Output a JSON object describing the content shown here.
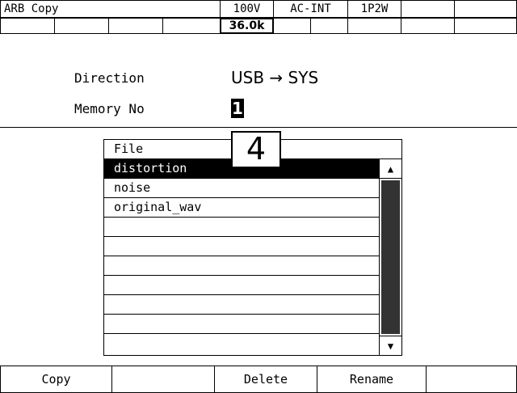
{
  "header": {
    "title": "ARB Copy",
    "voltage_range": "100V",
    "source_mode": "AC-INT",
    "wiring": "1P2W"
  },
  "status_bar": {
    "value": "36.0k"
  },
  "settings": {
    "direction_label": "Direction",
    "direction_value": "USB → SYS",
    "memory_label": "Memory No",
    "memory_value": "1",
    "memory_popup_value": "4"
  },
  "file_list": {
    "header": "File",
    "items": [
      "distortion",
      "noise",
      "original_wav",
      "",
      "",
      "",
      "",
      ""
    ],
    "selected_index": 0
  },
  "softkeys": [
    "Copy",
    "",
    "Delete",
    "Rename",
    ""
  ]
}
